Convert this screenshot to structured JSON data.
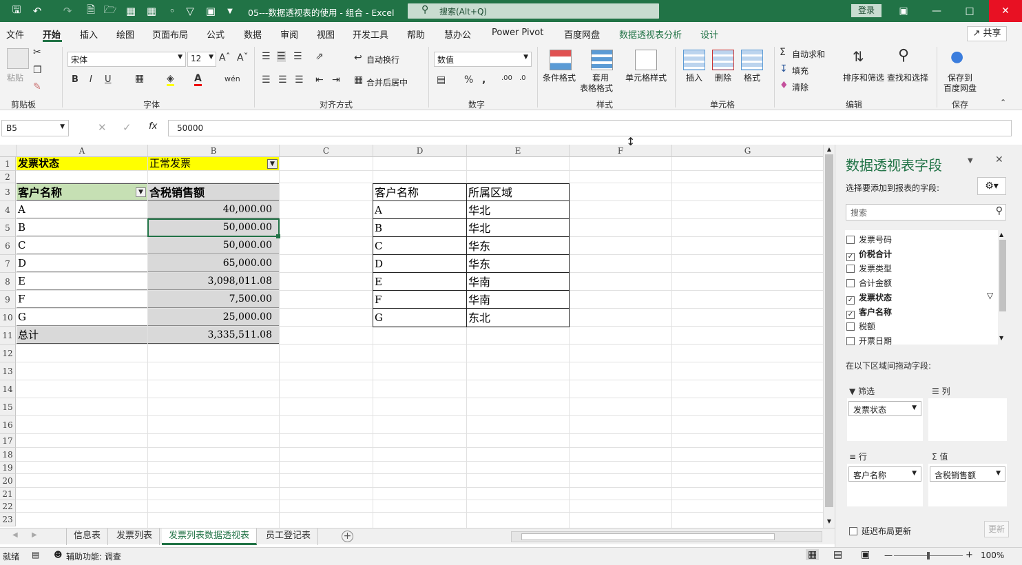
{
  "titlebar": {
    "doc_title": "05---数据透视表的使用 - 组合  -  Excel",
    "search_placeholder": "搜索(Alt+Q)",
    "login_label": "登录"
  },
  "menu": {
    "tabs": [
      "文件",
      "开始",
      "插入",
      "绘图",
      "页面布局",
      "公式",
      "数据",
      "审阅",
      "视图",
      "开发工具",
      "帮助",
      "慧办公",
      "Power Pivot",
      "百度网盘",
      "数据透视表分析",
      "设计"
    ],
    "share_label": "共享"
  },
  "ribbon": {
    "clipboard": {
      "paste": "粘贴",
      "group": "剪贴板"
    },
    "font": {
      "name": "宋体",
      "size": "12",
      "group": "字体",
      "bold": "B",
      "italic": "I",
      "underline": "U"
    },
    "alignment": {
      "wrap": "自动换行",
      "merge": "合并后居中",
      "group": "对齐方式"
    },
    "number": {
      "format": "数值",
      "group": "数字"
    },
    "styles": {
      "cond": "条件格式",
      "table1": "套用",
      "table2": "表格格式",
      "cell": "单元格样式",
      "group": "样式"
    },
    "cells": {
      "insert": "插入",
      "delete": "删除",
      "format": "格式",
      "group": "单元格"
    },
    "editing": {
      "autosum": "自动求和",
      "fill": "填充",
      "clear": "清除",
      "sort": "排序和筛选",
      "find": "查找和选择",
      "group": "编辑"
    },
    "save": {
      "l1": "保存到",
      "l2": "百度网盘",
      "group": "保存"
    }
  },
  "formula": {
    "namebox": "B5",
    "value": "50000"
  },
  "grid": {
    "columns": [
      "A",
      "B",
      "C",
      "D",
      "E",
      "F",
      "G"
    ],
    "rows": [
      "1",
      "2",
      "3",
      "4",
      "5",
      "6",
      "7",
      "8",
      "9",
      "10",
      "11",
      "12",
      "13",
      "14",
      "15",
      "16",
      "17",
      "18",
      "19",
      "20",
      "21",
      "22",
      "23"
    ],
    "filter_label": "发票状态",
    "filter_value": "正常发票",
    "pivot_headers": [
      "客户名称",
      "含税销售额"
    ],
    "pivot_rows": [
      {
        "name": "A",
        "value": "40,000.00"
      },
      {
        "name": "B",
        "value": "50,000.00"
      },
      {
        "name": "C",
        "value": "50,000.00"
      },
      {
        "name": "D",
        "value": "65,000.00"
      },
      {
        "name": "E",
        "value": "3,098,011.08"
      },
      {
        "name": "F",
        "value": "7,500.00"
      },
      {
        "name": "G",
        "value": "25,000.00"
      }
    ],
    "total_label": "总计",
    "total_value": "3,335,511.08",
    "region_headers": [
      "客户名称",
      "所属区域"
    ],
    "region_rows": [
      {
        "name": "A",
        "region": "华北"
      },
      {
        "name": "B",
        "region": "华北"
      },
      {
        "name": "C",
        "region": "华东"
      },
      {
        "name": "D",
        "region": "华东"
      },
      {
        "name": "E",
        "region": "华南"
      },
      {
        "name": "F",
        "region": "华南"
      },
      {
        "name": "G",
        "region": "东北"
      }
    ]
  },
  "sheets": {
    "tabs": [
      "信息表",
      "发票列表",
      "发票列表数据透视表",
      "员工登记表"
    ],
    "active": "发票列表数据透视表"
  },
  "status": {
    "ready": "就绪",
    "accessibility": "辅助功能: 调查",
    "zoom": "100%"
  },
  "pivot_panel": {
    "title": "数据透视表字段",
    "subtitle": "选择要添加到报表的字段:",
    "search_placeholder": "搜索",
    "fields": [
      {
        "label": "发票号码",
        "checked": false
      },
      {
        "label": "价税合计",
        "checked": true
      },
      {
        "label": "发票类型",
        "checked": false
      },
      {
        "label": "合计金额",
        "checked": false
      },
      {
        "label": "发票状态",
        "checked": true
      },
      {
        "label": "客户名称",
        "checked": true
      },
      {
        "label": "税额",
        "checked": false
      },
      {
        "label": "开票日期",
        "checked": false
      }
    ],
    "drag_hint": "在以下区域间拖动字段:",
    "zones": {
      "filter": {
        "label": "筛选",
        "item": "发票状态"
      },
      "columns": {
        "label": "列"
      },
      "rows": {
        "label": "行",
        "item": "客户名称"
      },
      "values": {
        "label": "值",
        "item": "含税销售额"
      }
    },
    "defer_label": "延迟布局更新",
    "update_label": "更新"
  }
}
